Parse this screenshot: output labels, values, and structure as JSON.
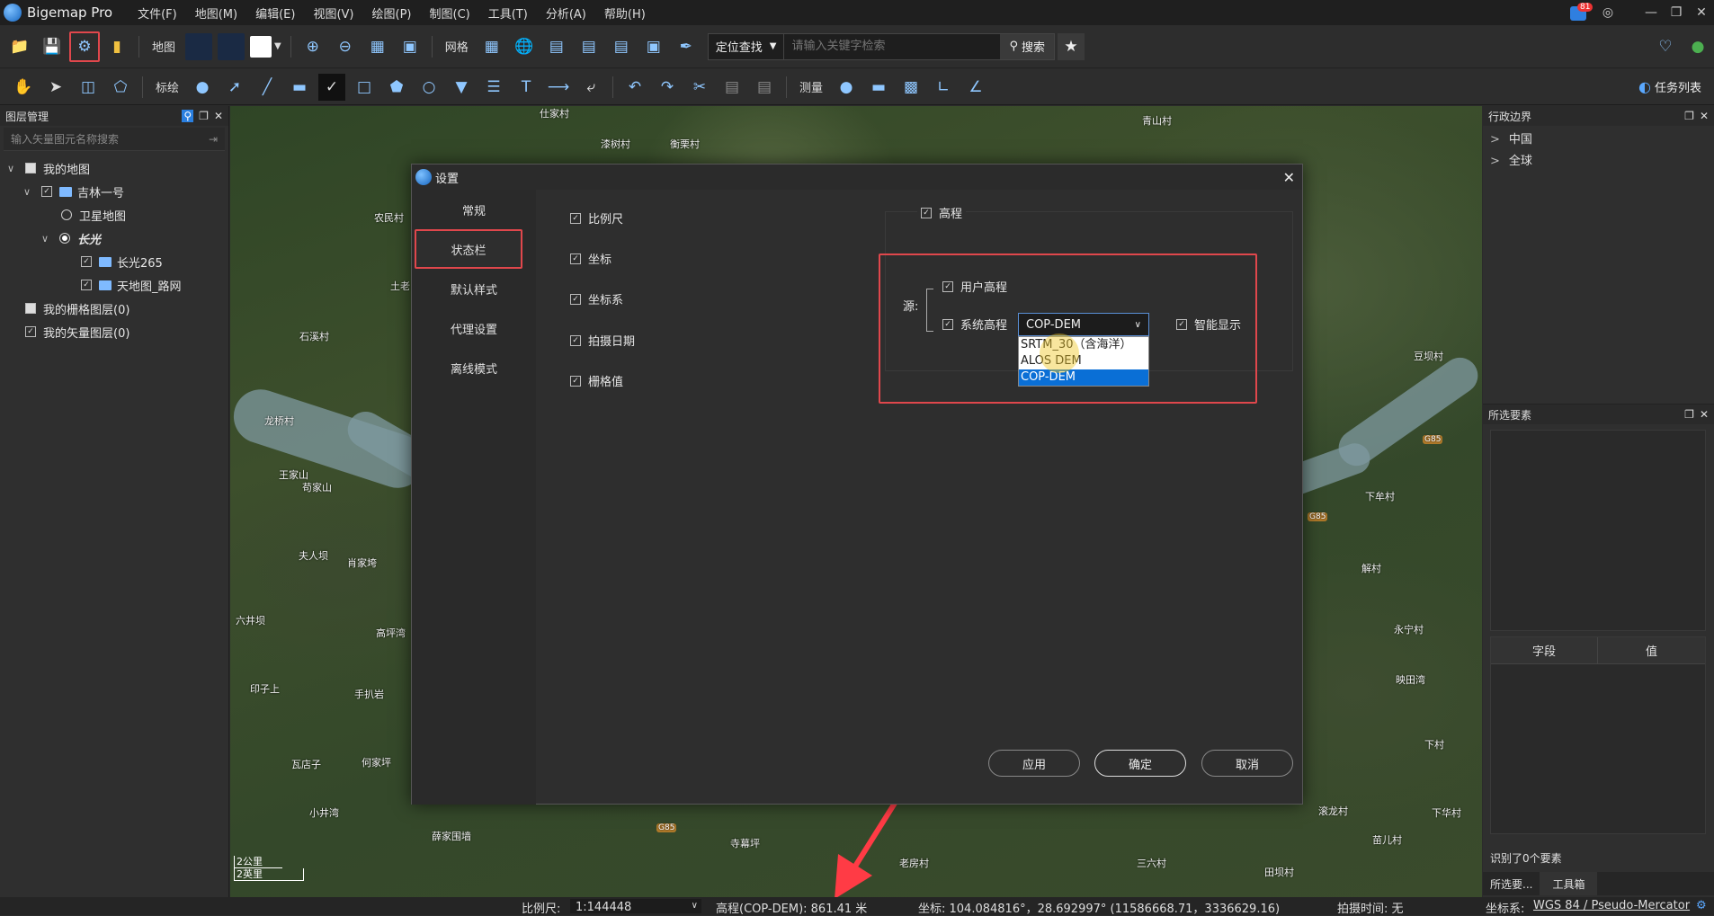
{
  "app": {
    "name": "Bigemap Pro",
    "menu": [
      "文件(F)",
      "地图(M)",
      "编辑(E)",
      "视图(V)",
      "绘图(P)",
      "制图(C)",
      "工具(T)",
      "分析(A)",
      "帮助(H)"
    ],
    "notif_count": "81"
  },
  "toolbar1": {
    "map_label": "地图",
    "grid_label": "网格",
    "search_mode": "定位查找",
    "search_placeholder": "请输入关键字检索",
    "search_button": "搜索"
  },
  "toolbar2": {
    "draw_label": "标绘",
    "measure_label": "测量",
    "tasks_label": "任务列表"
  },
  "left_panel": {
    "title": "图层管理",
    "filter_placeholder": "输入矢量图元名称搜索",
    "tree": [
      {
        "label": "我的地图"
      },
      {
        "label": "吉林一号"
      },
      {
        "label": "卫星地图"
      },
      {
        "label": "长光"
      },
      {
        "label": "长光265"
      },
      {
        "label": "天地图_路网"
      },
      {
        "label": "我的栅格图层(0)"
      },
      {
        "label": "我的矢量图层(0)"
      }
    ]
  },
  "right_panel": {
    "admin_title": "行政边界",
    "admin_items": [
      "中国",
      "全球"
    ],
    "selected_title": "所选要素",
    "col_field": "字段",
    "col_value": "值",
    "identified": "识别了0个要素",
    "tab_selected": "所选要...",
    "tab_toolbox": "工具箱"
  },
  "map": {
    "places": [
      "仕家村",
      "漆树村",
      "衡栗村",
      "青山村",
      "农民村",
      "土老",
      "石溪村",
      "龙桥村",
      "王家山",
      "苟家山",
      "夫人坝",
      "肖家垮",
      "六井坝",
      "高坪湾",
      "印子上",
      "手扒岩",
      "瓦店子",
      "何家坪",
      "小井湾",
      "薛家围墙",
      "寺幕坪",
      "老房村",
      "三六村",
      "田坝村",
      "下牟村",
      "解村",
      "永宁村",
      "映田湾",
      "下村",
      "滚龙村",
      "苗儿村",
      "下华村",
      "豆坝村",
      "G85",
      "G85",
      "G85"
    ],
    "scale_km": "2公里",
    "scale_mi": "2英里"
  },
  "dialog": {
    "title": "设置",
    "nav": [
      "常规",
      "状态栏",
      "默认样式",
      "代理设置",
      "离线模式"
    ],
    "options": [
      "比例尺",
      "坐标",
      "坐标系",
      "拍摄日期",
      "栅格值"
    ],
    "elev_group": "高程",
    "source_label": "源:",
    "user_elev": "用户高程",
    "sys_elev": "系统高程",
    "sys_elev_value": "COP-DEM",
    "smart_display": "智能显示",
    "dropdown_options": [
      "SRTM_30（含海洋）",
      "ALOS DEM",
      "COP-DEM"
    ],
    "btn_apply": "应用",
    "btn_ok": "确定",
    "btn_cancel": "取消"
  },
  "statusbar": {
    "scale_label": "比例尺:",
    "scale_value": "1:144448",
    "elevation": "高程(COP-DEM):  861.41 米",
    "coords": "坐标:  104.084816°，28.692997°  (11586668.71，3336629.16)",
    "capture_time": "拍摄时间:  无",
    "crs_label": "坐标系:",
    "crs_value": "WGS 84 / Pseudo-Mercator"
  },
  "colors": {
    "accent": "#0a6fd6",
    "highlight": "#e0474c",
    "annotation_arrow": "#ff3b45"
  }
}
